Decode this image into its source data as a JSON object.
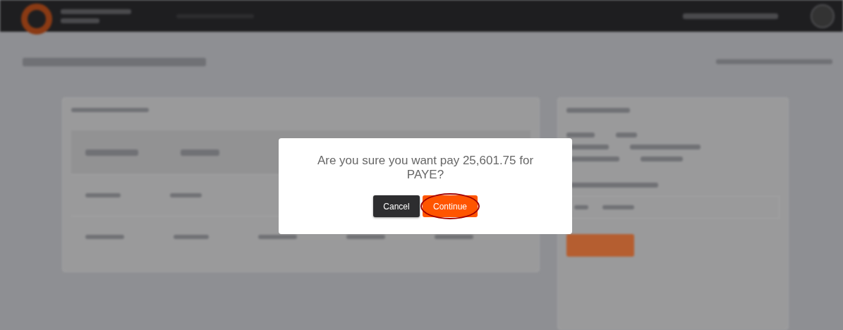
{
  "dialog": {
    "message": "Are you sure you want pay 25,601.75 for PAYE?",
    "buttons": [
      {
        "label": "Cancel",
        "kind": "secondary",
        "highlighted": false
      },
      {
        "label": "Continue",
        "kind": "primary",
        "highlighted": true
      }
    ]
  }
}
